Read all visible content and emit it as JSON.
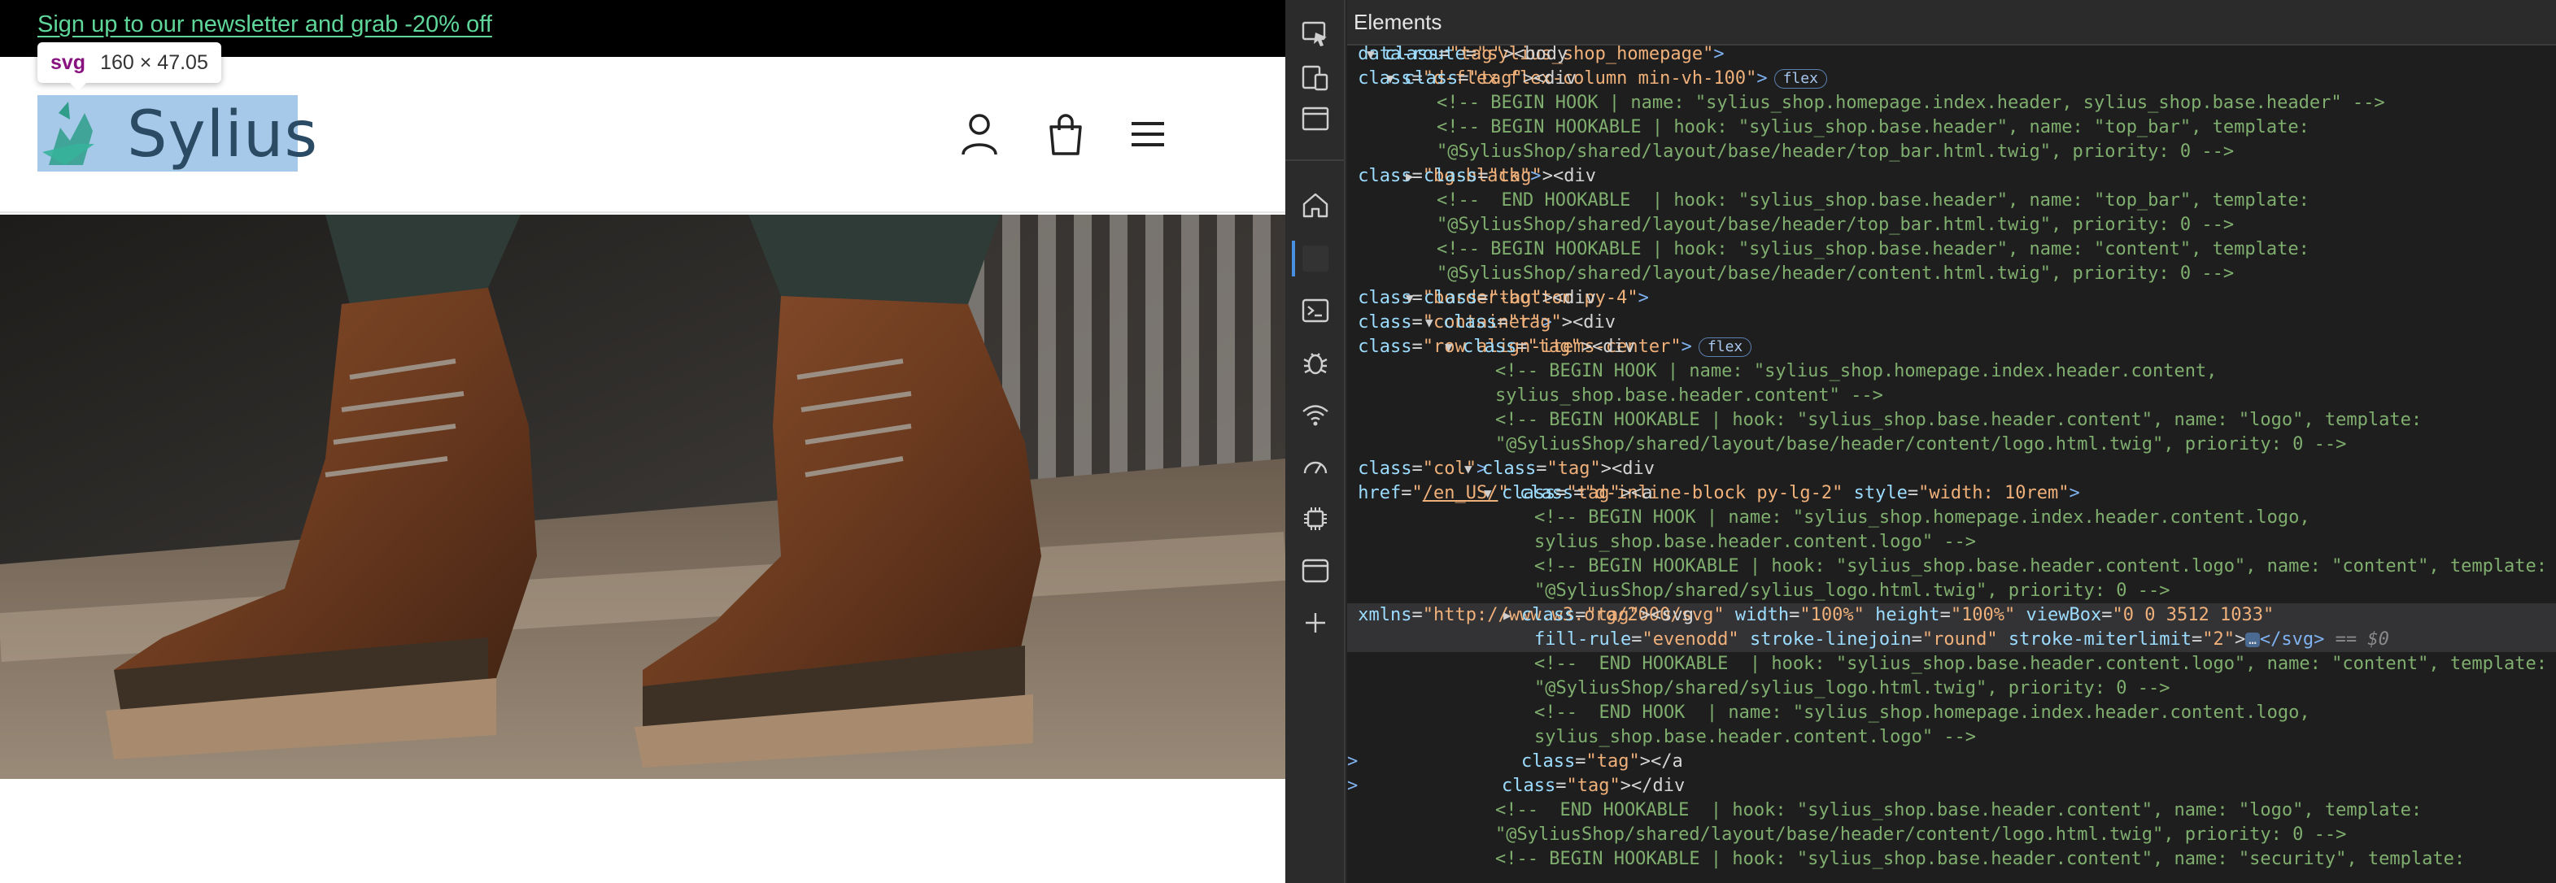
{
  "shop": {
    "newsletter": "Sign up to our newsletter and grab -20% off",
    "logo_text": "Sylius",
    "tooltip": {
      "tag": "svg",
      "size": "160 × 47.05"
    }
  },
  "devtools": {
    "panel_title": "Elements",
    "lines": [
      "<body data-route=\"sylius_shop_homepage\">",
      "<div class=\"d-flex flex-column min-vh-100\">",
      "<!-- BEGIN HOOK | name: \"sylius_shop.homepage.index.header, sylius_shop.base.header\" -->",
      "<!-- BEGIN HOOKABLE | hook: \"sylius_shop.base.header\", name: \"top_bar\", template:",
      "\"@SyliusShop/shared/layout/base/header/top_bar.html.twig\", priority: 0 -->",
      "<div class=\"bg-black\">",
      "<!--  END HOOKABLE  | hook: \"sylius_shop.base.header\", name: \"top_bar\", template:",
      "\"@SyliusShop/shared/layout/base/header/top_bar.html.twig\", priority: 0 -->",
      "<!-- BEGIN HOOKABLE | hook: \"sylius_shop.base.header\", name: \"content\", template:",
      "\"@SyliusShop/shared/layout/base/header/content.html.twig\", priority: 0 -->",
      "<div class=\"border-bottom py-4\">",
      "<div class=\"container\">",
      "<div class=\"row align-items-center\">",
      "<!-- BEGIN HOOK | name: \"sylius_shop.homepage.index.header.content,",
      "sylius_shop.base.header.content\" -->",
      "<!-- BEGIN HOOKABLE | hook: \"sylius_shop.base.header.content\", name: \"logo\", template:",
      "\"@SyliusShop/shared/layout/base/header/content/logo.html.twig\", priority: 0 -->",
      "<div class=\"col\">",
      "<a href=\"/en_US/\" class=\"d-inline-block py-lg-2\" style=\"width: 10rem\">",
      "<!-- BEGIN HOOK | name: \"sylius_shop.homepage.index.header.content.logo,",
      "sylius_shop.base.header.content.logo\" -->",
      "<!-- BEGIN HOOKABLE | hook: \"sylius_shop.base.header.content.logo\", name: \"content\", template:",
      "\"@SyliusShop/shared/sylius_logo.html.twig\", priority: 0 -->",
      "<svg xmlns=\"http://www.w3.org/2000/svg\" width=\"100%\" height=\"100%\" viewBox=\"0 0 3512 1033\"",
      "fill-rule=\"evenodd\" stroke-linejoin=\"round\" stroke-miterlimit=\"2\"></svg> == $0",
      "<!--  END HOOKABLE  | hook: \"sylius_shop.base.header.content.logo\", name: \"content\", template:",
      "\"@SyliusShop/shared/sylius_logo.html.twig\", priority: 0 -->",
      "<!--  END HOOK  | name: \"sylius_shop.homepage.index.header.content.logo,",
      "sylius_shop.base.header.content.logo\" -->",
      "</a>",
      "</div>",
      "<!--  END HOOKABLE  | hook: \"sylius_shop.base.header.content\", name: \"logo\", template:",
      "\"@SyliusShop/shared/layout/base/header/content/logo.html.twig\", priority: 0 -->",
      "<!-- BEGIN HOOKABLE | hook: \"sylius_shop.base.header.content\", name: \"security\", template:"
    ],
    "badges": {
      "flex": "flex",
      "ellipsis": "…"
    }
  },
  "colors": {
    "accent_green": "#5fd69a",
    "logo_highlight": "#6fa8dc",
    "tag_blue": "#7fb2f0",
    "comment_green": "#7fae6e"
  }
}
